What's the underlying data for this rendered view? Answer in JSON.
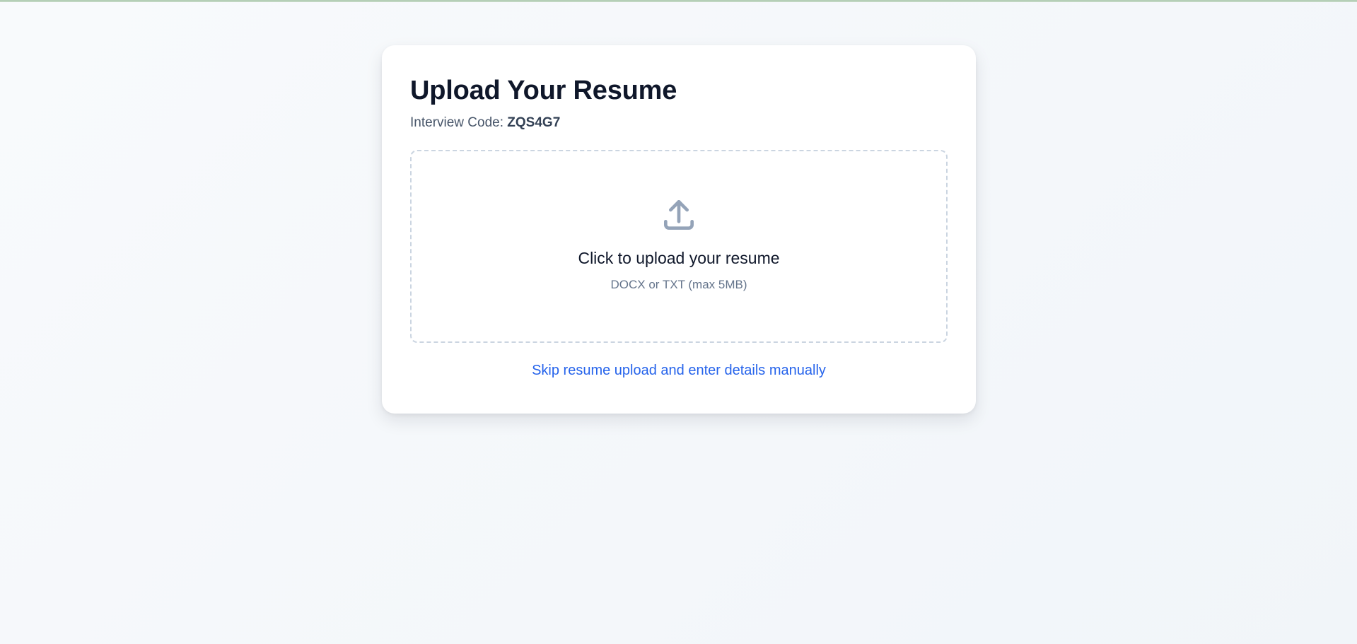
{
  "upload_card": {
    "title": "Upload Your Resume",
    "code_label": "Interview Code: ",
    "code_value": "ZQS4G7",
    "dropzone": {
      "icon": "upload-icon",
      "title": "Click to upload your resume",
      "hint": "DOCX or TXT (max 5MB)"
    },
    "skip_link": "Skip resume upload and enter details manually"
  },
  "colors": {
    "heading": "#0f172a",
    "link": "#2563eb",
    "icon": "#94a3b8",
    "muted": "#64748b"
  }
}
